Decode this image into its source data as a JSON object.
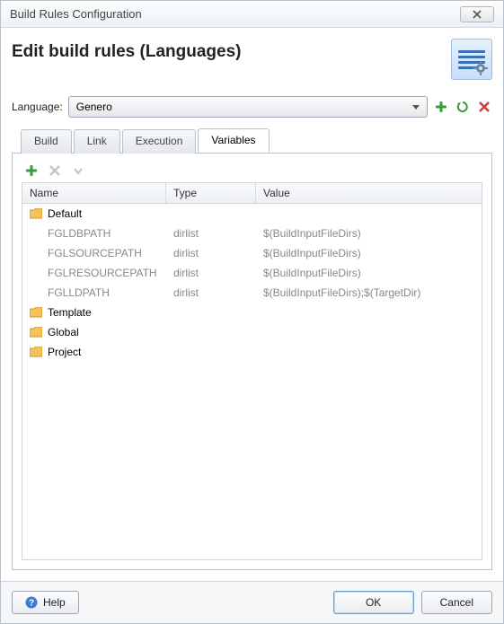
{
  "window": {
    "title": "Build Rules Configuration"
  },
  "header": {
    "title": "Edit build rules (Languages)"
  },
  "language": {
    "label": "Language:",
    "value": "Genero"
  },
  "tabs": {
    "build": "Build",
    "link": "Link",
    "execution": "Execution",
    "variables": "Variables",
    "active": "variables"
  },
  "columns": {
    "name": "Name",
    "type": "Type",
    "value": "Value"
  },
  "groups": {
    "default": "Default",
    "template": "Template",
    "global": "Global",
    "project": "Project"
  },
  "rows": [
    {
      "name": "FGLDBPATH",
      "type": "dirlist",
      "value": "$(BuildInputFileDirs)"
    },
    {
      "name": "FGLSOURCEPATH",
      "type": "dirlist",
      "value": "$(BuildInputFileDirs)"
    },
    {
      "name": "FGLRESOURCEPATH",
      "type": "dirlist",
      "value": "$(BuildInputFileDirs)"
    },
    {
      "name": "FGLLDPATH",
      "type": "dirlist",
      "value": "$(BuildInputFileDirs);$(TargetDir)"
    }
  ],
  "buttons": {
    "help": "Help",
    "ok": "OK",
    "cancel": "Cancel"
  }
}
